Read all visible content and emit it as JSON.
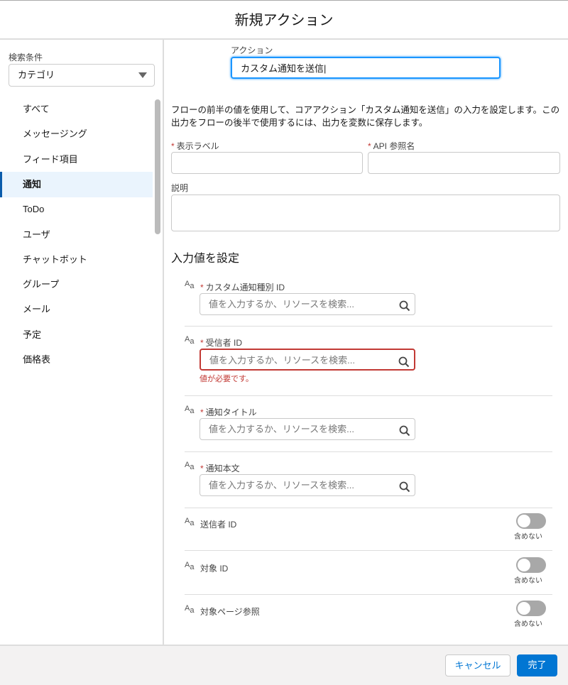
{
  "modal": {
    "title": "新規アクション"
  },
  "sidebar": {
    "filter_label": "検索条件",
    "filter_value": "カテゴリ",
    "items": [
      {
        "label": "すべて"
      },
      {
        "label": "メッセージング"
      },
      {
        "label": "フィード項目"
      },
      {
        "label": "通知",
        "active": true
      },
      {
        "label": "ToDo"
      },
      {
        "label": "ユーザ"
      },
      {
        "label": "チャットボット"
      },
      {
        "label": "グループ"
      },
      {
        "label": "メール"
      },
      {
        "label": "予定"
      },
      {
        "label": "価格表"
      }
    ]
  },
  "main": {
    "action_label": "アクション",
    "action_value": "カスタム通知を送信",
    "description": "フローの前半の値を使用して、コアアクション「カスタム通知を送信」の入力を設定します。この出力をフローの後半で使用するには、出力を変数に保存します。",
    "display_label": "表示ラベル",
    "api_name": "API 参照名",
    "desc_label": "説明",
    "section_title": "入力値を設定",
    "placeholder": "値を入力するか、リソースを検索...",
    "required_inputs": [
      {
        "label": "カスタム通知種別 ID"
      },
      {
        "label": "受信者 ID",
        "error": "値が必要です。"
      },
      {
        "label": "通知タイトル"
      },
      {
        "label": "通知本文"
      }
    ],
    "optional_inputs": [
      {
        "label": "送信者 ID",
        "toggle": "含めない",
        "on": false
      },
      {
        "label": "対象 ID",
        "toggle": "含めない",
        "on": false
      },
      {
        "label": "対象ページ参照",
        "toggle": "含めない",
        "on": false
      }
    ],
    "type_icon": "Aa"
  },
  "footer": {
    "cancel": "キャンセル",
    "done": "完了"
  },
  "colors": {
    "brand": "#0176d3",
    "error": "#c23934",
    "focus": "#1b96ff"
  }
}
